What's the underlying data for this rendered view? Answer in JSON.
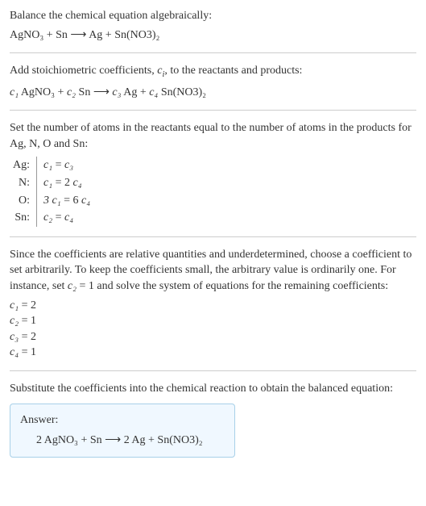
{
  "section1": {
    "title": "Balance the chemical equation algebraically:",
    "eq": "AgNO₃ + Sn ⟶ Ag + Sn(NO3)₂"
  },
  "section2": {
    "title_a": "Add stoichiometric coefficients, ",
    "title_ci": "c",
    "title_sub": "i",
    "title_b": ", to the reactants and products:",
    "eq_c1": "c₁",
    "eq_a": " AgNO₃ + ",
    "eq_c2": "c₂",
    "eq_b": " Sn ⟶ ",
    "eq_c3": "c₃",
    "eq_c": " Ag + ",
    "eq_c4": "c₄",
    "eq_d": " Sn(NO3)₂"
  },
  "section3": {
    "title": "Set the number of atoms in the reactants equal to the number of atoms in the products for Ag, N, O and Sn:",
    "rows": [
      {
        "el": "Ag:",
        "lhs": "c₁",
        "op": " = ",
        "rhs": "c₃"
      },
      {
        "el": "N:",
        "lhs": "c₁",
        "op": " = 2 ",
        "rhs": "c₄"
      },
      {
        "el": "O:",
        "lhs": "3 c₁",
        "op": " = 6 ",
        "rhs": "c₄"
      },
      {
        "el": "Sn:",
        "lhs": "c₂",
        "op": " = ",
        "rhs": "c₄"
      }
    ]
  },
  "section4": {
    "text_a": "Since the coefficients are relative quantities and underdetermined, choose a coefficient to set arbitrarily. To keep the coefficients small, the arbitrary value is ordinarily one. For instance, set ",
    "text_c2": "c₂",
    "text_b": " = 1 and solve the system of equations for the remaining coefficients:",
    "coeffs": [
      {
        "c": "c₁",
        "v": " = 2"
      },
      {
        "c": "c₂",
        "v": " = 1"
      },
      {
        "c": "c₃",
        "v": " = 2"
      },
      {
        "c": "c₄",
        "v": " = 1"
      }
    ]
  },
  "section5": {
    "title": "Substitute the coefficients into the chemical reaction to obtain the balanced equation:",
    "answer_label": "Answer:",
    "answer_eq": "2 AgNO₃ + Sn ⟶ 2 Ag + Sn(NO3)₂"
  }
}
